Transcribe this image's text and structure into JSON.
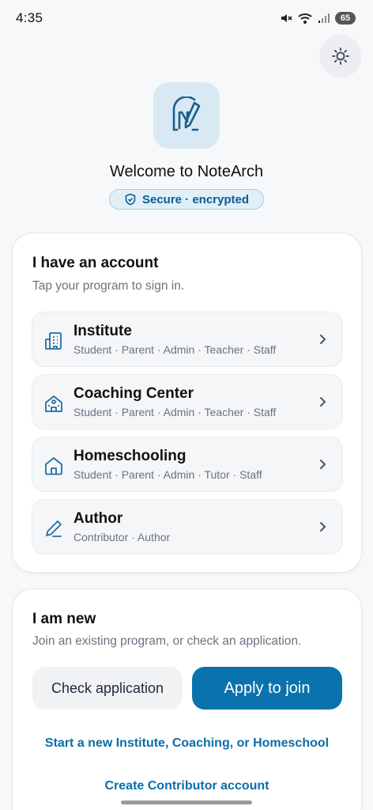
{
  "status_bar": {
    "time": "4:35",
    "battery": "65",
    "icons": [
      "mute-icon",
      "wifi-icon",
      "signal-icon",
      "battery-icon"
    ]
  },
  "theme_toggle": {
    "icon": "sun-icon"
  },
  "logo": {
    "icon": "notearch-logo-icon"
  },
  "header": {
    "welcome": "Welcome to NoteArch",
    "secure_badge": "Secure · encrypted"
  },
  "account": {
    "title": "I have an account",
    "subtitle": "Tap your program to sign in.",
    "programs": [
      {
        "name": "Institute",
        "roles": "Student · Parent · Admin · Teacher · Staff",
        "icon": "building-icon"
      },
      {
        "name": "Coaching Center",
        "roles": "Student · Parent · Admin · Teacher · Staff",
        "icon": "school-icon"
      },
      {
        "name": "Homeschooling",
        "roles": "Student · Parent · Admin · Tutor · Staff",
        "icon": "home-icon"
      },
      {
        "name": "Author",
        "roles": "Contributor · Author",
        "icon": "pen-icon"
      }
    ]
  },
  "new_user": {
    "title": "I am new",
    "subtitle": "Join an existing program, or check an application.",
    "check_label": "Check application",
    "apply_label": "Apply to join",
    "start_link": "Start a new Institute, Coaching, or Homeschool",
    "contributor_link": "Create Contributor account"
  },
  "colors": {
    "accent": "#0a72ad",
    "link": "#0a6ea8",
    "icon_blue": "#1f6fa5",
    "logo_bg": "#d8e9f3"
  }
}
